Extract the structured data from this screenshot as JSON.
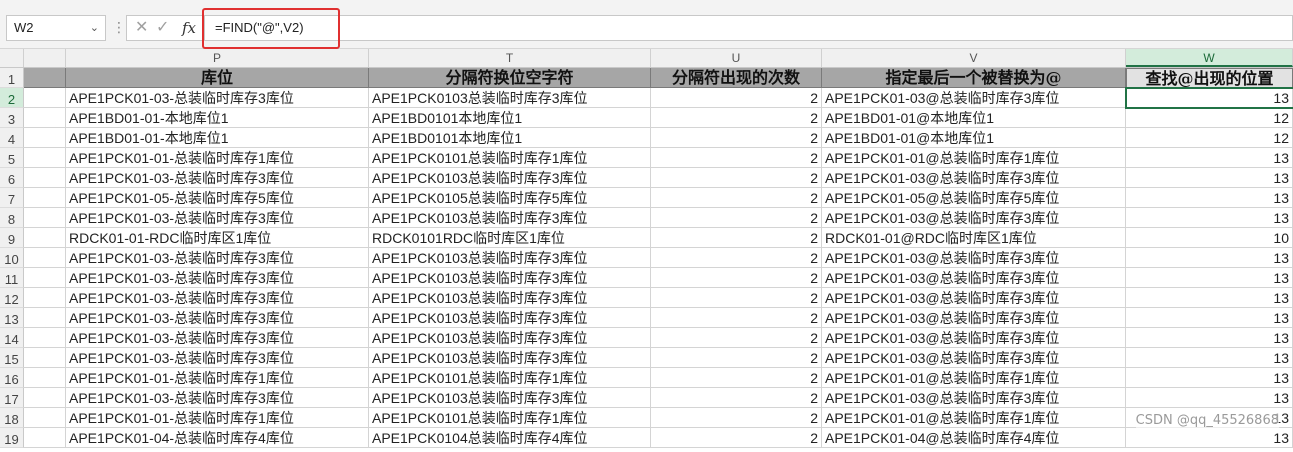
{
  "name_box": "W2",
  "formula": "=FIND(\"@\",V2)",
  "columns": [
    "P",
    "T",
    "U",
    "V",
    "W"
  ],
  "headers": [
    "库位",
    "分隔符换位空字符",
    "分隔符出现的次数",
    "指定最后一个被替换为@",
    "查找@出现的位置"
  ],
  "rows": [
    {
      "num": "1"
    },
    {
      "num": "2",
      "p": "APE1PCK01-03-总装临时库存3库位",
      "t": "APE1PCK0103总装临时库存3库位",
      "u": "2",
      "v": "APE1PCK01-03@总装临时库存3库位",
      "w": "13"
    },
    {
      "num": "3",
      "p": "APE1BD01-01-本地库位1",
      "t": "APE1BD0101本地库位1",
      "u": "2",
      "v": "APE1BD01-01@本地库位1",
      "w": "12"
    },
    {
      "num": "4",
      "p": "APE1BD01-01-本地库位1",
      "t": "APE1BD0101本地库位1",
      "u": "2",
      "v": "APE1BD01-01@本地库位1",
      "w": "12"
    },
    {
      "num": "5",
      "p": "APE1PCK01-01-总装临时库存1库位",
      "t": "APE1PCK0101总装临时库存1库位",
      "u": "2",
      "v": "APE1PCK01-01@总装临时库存1库位",
      "w": "13"
    },
    {
      "num": "6",
      "p": "APE1PCK01-03-总装临时库存3库位",
      "t": "APE1PCK0103总装临时库存3库位",
      "u": "2",
      "v": "APE1PCK01-03@总装临时库存3库位",
      "w": "13"
    },
    {
      "num": "7",
      "p": "APE1PCK01-05-总装临时库存5库位",
      "t": "APE1PCK0105总装临时库存5库位",
      "u": "2",
      "v": "APE1PCK01-05@总装临时库存5库位",
      "w": "13"
    },
    {
      "num": "8",
      "p": "APE1PCK01-03-总装临时库存3库位",
      "t": "APE1PCK0103总装临时库存3库位",
      "u": "2",
      "v": "APE1PCK01-03@总装临时库存3库位",
      "w": "13"
    },
    {
      "num": "9",
      "p": "RDCK01-01-RDC临时库区1库位",
      "t": "RDCK0101RDC临时库区1库位",
      "u": "2",
      "v": "RDCK01-01@RDC临时库区1库位",
      "w": "10"
    },
    {
      "num": "10",
      "p": "APE1PCK01-03-总装临时库存3库位",
      "t": "APE1PCK0103总装临时库存3库位",
      "u": "2",
      "v": "APE1PCK01-03@总装临时库存3库位",
      "w": "13"
    },
    {
      "num": "11",
      "p": "APE1PCK01-03-总装临时库存3库位",
      "t": "APE1PCK0103总装临时库存3库位",
      "u": "2",
      "v": "APE1PCK01-03@总装临时库存3库位",
      "w": "13"
    },
    {
      "num": "12",
      "p": "APE1PCK01-03-总装临时库存3库位",
      "t": "APE1PCK0103总装临时库存3库位",
      "u": "2",
      "v": "APE1PCK01-03@总装临时库存3库位",
      "w": "13"
    },
    {
      "num": "13",
      "p": "APE1PCK01-03-总装临时库存3库位",
      "t": "APE1PCK0103总装临时库存3库位",
      "u": "2",
      "v": "APE1PCK01-03@总装临时库存3库位",
      "w": "13"
    },
    {
      "num": "14",
      "p": "APE1PCK01-03-总装临时库存3库位",
      "t": "APE1PCK0103总装临时库存3库位",
      "u": "2",
      "v": "APE1PCK01-03@总装临时库存3库位",
      "w": "13"
    },
    {
      "num": "15",
      "p": "APE1PCK01-03-总装临时库存3库位",
      "t": "APE1PCK0103总装临时库存3库位",
      "u": "2",
      "v": "APE1PCK01-03@总装临时库存3库位",
      "w": "13"
    },
    {
      "num": "16",
      "p": "APE1PCK01-01-总装临时库存1库位",
      "t": "APE1PCK0101总装临时库存1库位",
      "u": "2",
      "v": "APE1PCK01-01@总装临时库存1库位",
      "w": "13"
    },
    {
      "num": "17",
      "p": "APE1PCK01-03-总装临时库存3库位",
      "t": "APE1PCK0103总装临时库存3库位",
      "u": "2",
      "v": "APE1PCK01-03@总装临时库存3库位",
      "w": "13"
    },
    {
      "num": "18",
      "p": "APE1PCK01-01-总装临时库存1库位",
      "t": "APE1PCK0101总装临时库存1库位",
      "u": "2",
      "v": "APE1PCK01-01@总装临时库存1库位",
      "w": "13"
    },
    {
      "num": "19",
      "p": "APE1PCK01-04-总装临时库存4库位",
      "t": "APE1PCK0104总装临时库存4库位",
      "u": "2",
      "v": "APE1PCK01-04@总装临时库存4库位",
      "w": "13"
    }
  ],
  "watermark": "CSDN @qq_45526868",
  "colors": {
    "selection": "#217346",
    "header_fill": "#a6a6a6",
    "highlight_box": "#e03030"
  }
}
